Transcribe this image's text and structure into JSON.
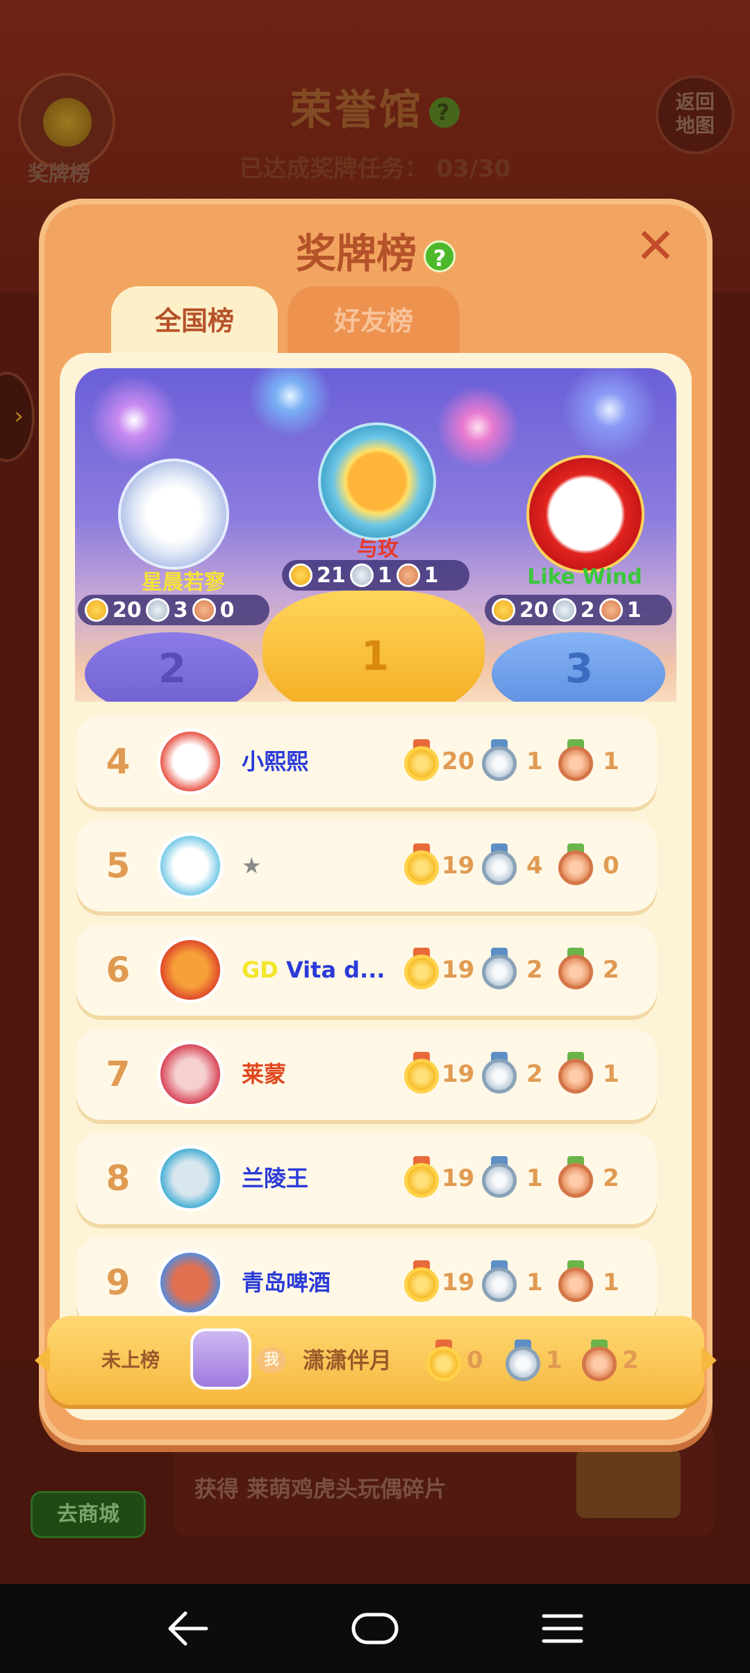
{
  "background": {
    "hall_title": "荣誉馆",
    "hall_help": "?",
    "progress": "已达成奖牌任务： 03/30",
    "medal_button_label": "奖牌榜",
    "back_button_label": "返回\n地图",
    "shop_button_label": "去商城",
    "reward_text": "获得 莱萌鸡虎头玩偶碎片"
  },
  "modal": {
    "title": "奖牌榜",
    "help": "?",
    "close": "✕",
    "tabs": [
      {
        "label": "全国榜",
        "active": true
      },
      {
        "label": "好友榜",
        "active": false
      }
    ]
  },
  "top3": [
    {
      "rank": "1",
      "name": "与玫",
      "name_color": "#e53a2a",
      "gold": "21",
      "silver": "1",
      "bronze": "1"
    },
    {
      "rank": "2",
      "name": "星晨若寥",
      "name_color": "#f7e23a",
      "gold": "20",
      "silver": "3",
      "bronze": "0"
    },
    {
      "rank": "3",
      "name": "Like  Wind",
      "name_color": "#3ac73a",
      "gold": "20",
      "silver": "2",
      "bronze": "1"
    }
  ],
  "rankings": [
    {
      "rank": "4",
      "name": "小熙熙",
      "name_color": "#2a3ad8",
      "gold": "20",
      "silver": "1",
      "bronze": "1"
    },
    {
      "rank": "5",
      "name": "★",
      "name_color": "#8a8a8a",
      "gold": "19",
      "silver": "4",
      "bronze": "0"
    },
    {
      "rank": "6",
      "name_prefix": "GD",
      "name": "Vita d...",
      "name_color": "#2a3ad8",
      "prefix_color": "#f2e62a",
      "gold": "19",
      "silver": "2",
      "bronze": "2"
    },
    {
      "rank": "7",
      "name": "莱蒙",
      "name_color": "#e0461e",
      "gold": "19",
      "silver": "2",
      "bronze": "1"
    },
    {
      "rank": "8",
      "name": "兰陵王",
      "name_color": "#2a3ad8",
      "gold": "19",
      "silver": "1",
      "bronze": "2"
    },
    {
      "rank": "9",
      "name": "青岛啤酒",
      "name_color": "#2a3ad8",
      "gold": "19",
      "silver": "1",
      "bronze": "1"
    }
  ],
  "self": {
    "rank_label": "未上榜",
    "me_badge": "我",
    "name": "潇潇伴月",
    "gold": "0",
    "silver": "1",
    "bronze": "2"
  },
  "colors": {
    "modal_bg": "#f2a560",
    "title": "#b5522a",
    "rank_number": "#e09a52",
    "row_bg": "#fff8e6"
  },
  "icons": {
    "gold": "gold-medal-icon",
    "silver": "silver-medal-icon",
    "bronze": "bronze-medal-icon",
    "close": "close-icon",
    "help": "help-icon"
  }
}
